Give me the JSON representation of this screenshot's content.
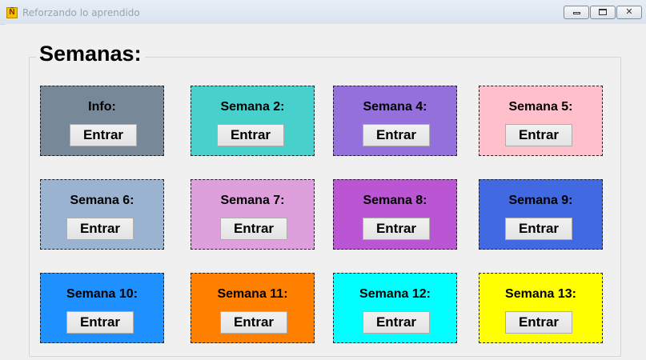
{
  "window": {
    "title": "Reforzando lo aprendido",
    "app_icon_glyph": "Ñ"
  },
  "group": {
    "title": "Semanas:"
  },
  "cards": [
    {
      "label": "Info:",
      "button": "Entrar",
      "color": "#778899"
    },
    {
      "label": "Semana 2:",
      "button": "Entrar",
      "color": "#48d1cc"
    },
    {
      "label": "Semana 4:",
      "button": "Entrar",
      "color": "#9370db"
    },
    {
      "label": "Semana 5:",
      "button": "Entrar",
      "color": "#ffc0cb"
    },
    {
      "label": "Semana 6:",
      "button": "Entrar",
      "color": "#9ab3d0"
    },
    {
      "label": "Semana 7:",
      "button": "Entrar",
      "color": "#dda0dd"
    },
    {
      "label": "Semana 8:",
      "button": "Entrar",
      "color": "#ba55d3"
    },
    {
      "label": "Semana 9:",
      "button": "Entrar",
      "color": "#4169e1"
    },
    {
      "label": "Semana 10:",
      "button": "Entrar",
      "color": "#1e90ff"
    },
    {
      "label": "Semana 11:",
      "button": "Entrar",
      "color": "#ff7f00"
    },
    {
      "label": "Semana 12:",
      "button": "Entrar",
      "color": "#00ffff"
    },
    {
      "label": "Semana 13:",
      "button": "Entrar",
      "color": "#ffff00"
    }
  ]
}
